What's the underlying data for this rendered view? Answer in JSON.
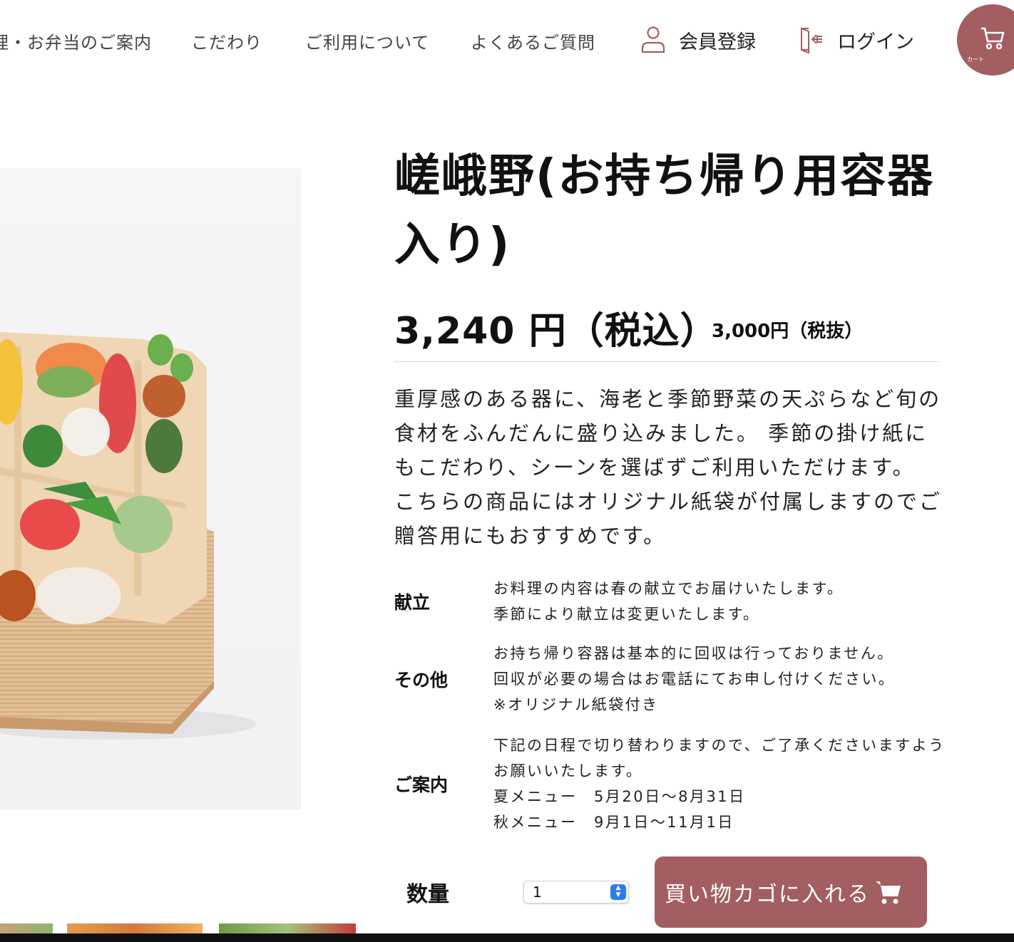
{
  "header": {
    "nav": [
      "理・お弁当のご案内",
      "こだわり",
      "ご利用について",
      "よくあるご質問"
    ],
    "register_label": "会員登録",
    "login_label": "ログイン",
    "cart_caption": "カート",
    "accent_color": "#a35e61"
  },
  "product": {
    "title": "嵯峨野(お持ち帰り用容器入り)",
    "price_incl": "3,240 円（税込）",
    "price_excl": "3,000円（税抜）",
    "description": "重厚感のある器に、海老と季節野菜の天ぷらなど旬の食材をふんだんに盛り込みました。 季節の掛け紙にもこだわり、シーンを選ばずご利用いただけます。 こちらの商品にはオリジナル紙袋が付属しますのでご贈答用にもおすすめです。",
    "info": [
      {
        "label": "献立",
        "lines": [
          "お料理の内容は春の献立でお届けいたします。",
          "季節により献立は変更いたします。"
        ]
      },
      {
        "label": "その他",
        "lines": [
          "お持ち帰り容器は基本的に回収は行っておりません。",
          "回収が必要の場合はお電話にてお申し付けください。",
          "※オリジナル紙袋付き"
        ]
      },
      {
        "label": "ご案内",
        "lines": [
          "下記の日程で切り替わりますので、ご了承くださいますよう",
          "お願いいたします。",
          "夏メニュー　5月20日〜8月31日",
          "秋メニュー　9月1日〜11月1日"
        ]
      }
    ],
    "quantity_label": "数量",
    "quantity_value": "1",
    "add_to_cart_label": "買い物カゴに入れる"
  },
  "icons": {
    "register": "person-icon",
    "login": "login-icon",
    "cart": "cart-icon",
    "add_cart": "cart-icon"
  }
}
